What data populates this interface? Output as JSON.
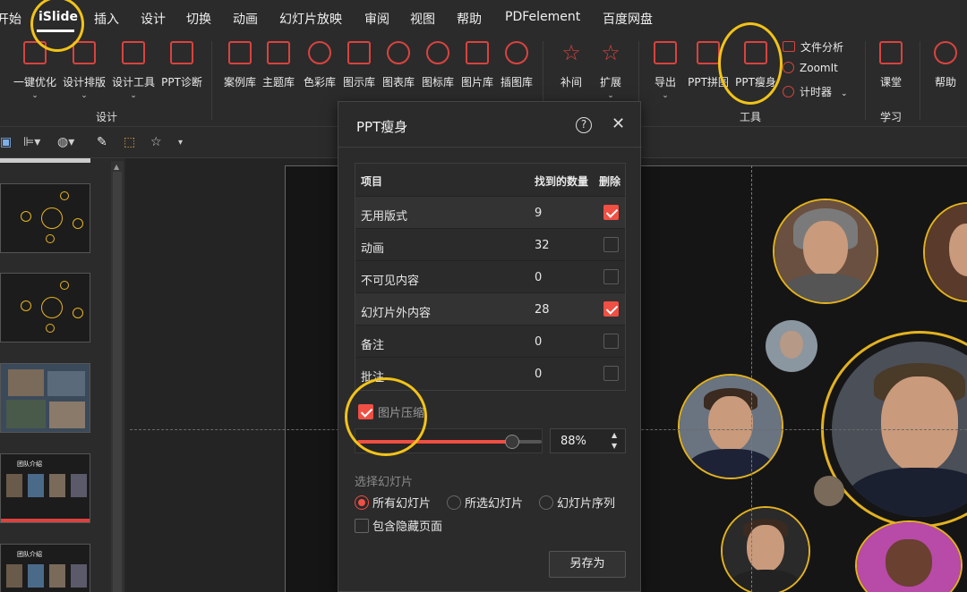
{
  "menu": {
    "items": [
      "开始",
      "iSlide",
      "插入",
      "设计",
      "切换",
      "动画",
      "幻灯片放映",
      "审阅",
      "视图",
      "帮助",
      "PDFelement",
      "百度网盘"
    ],
    "active": "iSlide"
  },
  "ribbon": {
    "buttons": [
      "一键优化",
      "设计排版",
      "设计工具",
      "PPT诊断",
      "案例库",
      "主题库",
      "色彩库",
      "图示库",
      "图表库",
      "图标库",
      "图片库",
      "插图库",
      "补间",
      "扩展",
      "导出",
      "PPT拼图",
      "PPT瘦身",
      "课堂",
      "帮助"
    ],
    "small_tools": [
      "文件分析",
      "ZoomIt",
      "计时器"
    ],
    "groups": [
      "设计",
      "工具",
      "学习"
    ],
    "accent": "#d9433f"
  },
  "thumbs": {
    "slide_title": "团队介绍"
  },
  "dialog": {
    "title": "PPT瘦身",
    "help_icon": "question-circle-icon",
    "close_icon": "close-icon",
    "table": {
      "headers": [
        "项目",
        "找到的数量",
        "删除"
      ],
      "rows": [
        {
          "name": "无用版式",
          "count": "9",
          "checked": true
        },
        {
          "name": "动画",
          "count": "32",
          "checked": false
        },
        {
          "name": "不可见内容",
          "count": "0",
          "checked": false
        },
        {
          "name": "幻灯片外内容",
          "count": "28",
          "checked": true
        },
        {
          "name": "备注",
          "count": "0",
          "checked": false
        },
        {
          "name": "批注",
          "count": "0",
          "checked": false
        }
      ]
    },
    "image_compress": {
      "label": "图片压缩",
      "checked": true,
      "value": "88%",
      "level": 0.88
    },
    "select_slides": {
      "header": "选择幻灯片",
      "options": [
        "所有幻灯片",
        "所选幻灯片",
        "幻灯片序列"
      ],
      "selected": "所有幻灯片",
      "include_hidden": "包含隐藏页面"
    },
    "save_button": "另存为"
  },
  "colors": {
    "accent_red": "#f04f43",
    "highlight_yellow": "#f2c318",
    "photo_ring": "#e3b21f"
  }
}
